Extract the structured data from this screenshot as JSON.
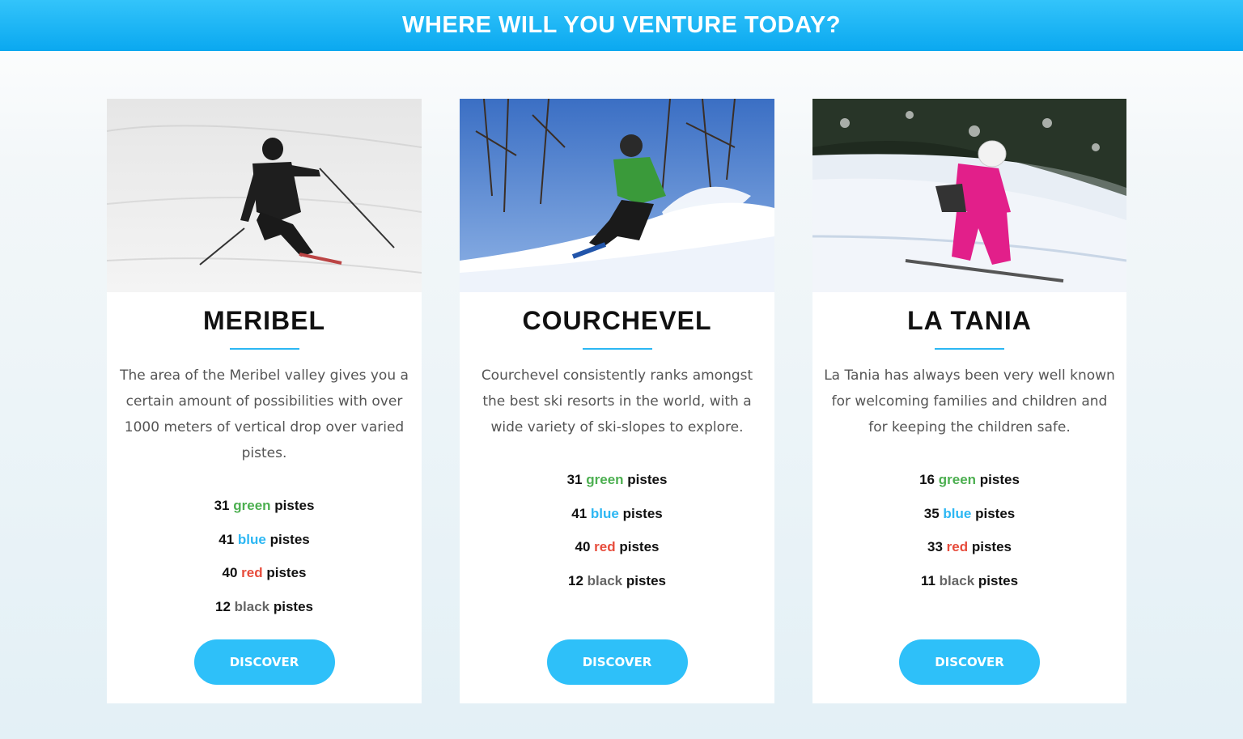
{
  "header": {
    "title": "WHERE WILL YOU VENTURE TODAY?"
  },
  "resorts": [
    {
      "name": "MERIBEL",
      "description": "The area of the Meribel valley gives you a certain amount of possibilities with over 1000 meters of vertical drop over varied pistes.",
      "pistes": [
        {
          "count": "31",
          "color": "green",
          "suffix": "pistes"
        },
        {
          "count": "41",
          "color": "blue",
          "suffix": "pistes"
        },
        {
          "count": "40",
          "color": "red",
          "suffix": "pistes"
        },
        {
          "count": "12",
          "color": "black",
          "suffix": "pistes"
        }
      ],
      "button": "DISCOVER"
    },
    {
      "name": "COURCHEVEL",
      "description": "Courchevel consistently ranks amongst the best ski resorts in the world, with a wide variety of ski-slopes to explore.",
      "pistes": [
        {
          "count": "31",
          "color": "green",
          "suffix": "pistes"
        },
        {
          "count": "41",
          "color": "blue",
          "suffix": "pistes"
        },
        {
          "count": "40",
          "color": "red",
          "suffix": "pistes"
        },
        {
          "count": "12",
          "color": "black",
          "suffix": "pistes"
        }
      ],
      "button": "DISCOVER"
    },
    {
      "name": "LA TANIA",
      "description": "La Tania has always been very well known for welcoming families and children and for keeping the children safe.",
      "pistes": [
        {
          "count": "16",
          "color": "green",
          "suffix": "pistes"
        },
        {
          "count": "35",
          "color": "blue",
          "suffix": "pistes"
        },
        {
          "count": "33",
          "color": "red",
          "suffix": "pistes"
        },
        {
          "count": "11",
          "color": "black",
          "suffix": "pistes"
        }
      ],
      "button": "DISCOVER"
    }
  ],
  "colors": {
    "accent": "#2ec0f9",
    "green": "#4caf50",
    "blue": "#2cb7f3",
    "red": "#e74c3c",
    "black": "#666666"
  }
}
